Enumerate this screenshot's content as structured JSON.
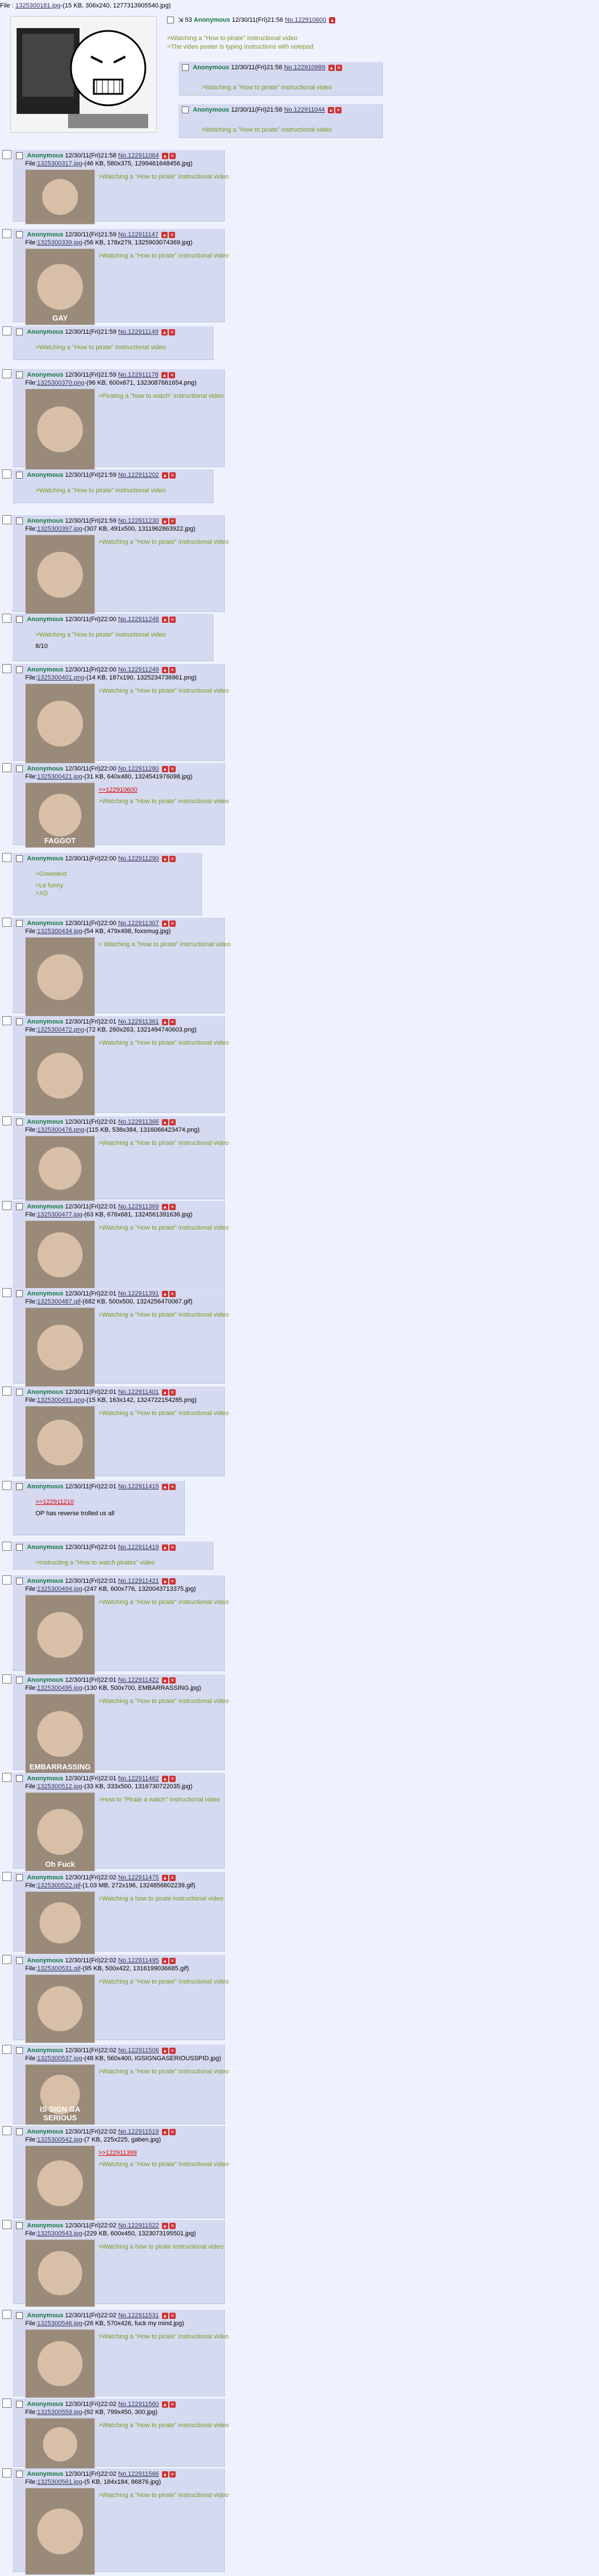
{
  "op": {
    "file_prefix": "File : ",
    "file_name": "1325300181.jpg",
    "file_info": "-(15 KB, 306x240, 1277313905540.jpg)",
    "reply_count": "53",
    "name": "Anonymous",
    "datetime": "12/30/11(Fri)21:56",
    "post_no": "No.122910600",
    "message": [
      ">Watching a \"How to pirate\" instructional video",
      ">The video poster is typing instructions with notepad"
    ],
    "nested_replies": [
      {
        "name": "Anonymous",
        "datetime": "12/30/11(Fri)21:58",
        "post_no": "No.122910999",
        "message": ">Watching a \"How to pirate\" instructional video"
      },
      {
        "name": "Anonymous",
        "datetime": "12/30/11(Fri)21:58",
        "post_no": "No.122911044",
        "message": ">Watching a \"How to pirate\" instructional video"
      }
    ]
  },
  "replies": [
    {
      "name": "Anonymous",
      "datetime": "12/30/11(Fri)21:58",
      "post_no": "No.122911064",
      "file_prefix": "File:",
      "file_name": "1325300317.jpg",
      "file_info": "-(46 KB, 580x375, 1299461648456.jpg)",
      "message": ">Watching a \"How to pirate\" instructional video"
    },
    {
      "name": "Anonymous",
      "datetime": "12/30/11(Fri)21:59",
      "post_no": "No.122911147",
      "file_prefix": "File:",
      "file_name": "1325300339.jpg",
      "file_info": "-(56 KB, 178x279, 1325903074369.jpg)",
      "message": ">Watching a \"How to pirate\" instructional video",
      "thumb_text": "GAY"
    },
    {
      "name": "Anonymous",
      "datetime": "12/30/11(Fri)21:59",
      "post_no": "No.122911149",
      "message": ">Watching a \"How to pirate\" instructional video"
    },
    {
      "name": "Anonymous",
      "datetime": "12/30/11(Fri)21:59",
      "post_no": "No.122911178",
      "file_prefix": "File:",
      "file_name": "1325300370.png",
      "file_info": "-(96 KB, 600x671, 1323087661654.png)",
      "message": ">Pirating a \"how to watch\" instructional video"
    },
    {
      "name": "Anonymous",
      "datetime": "12/30/11(Fri)21:59",
      "post_no": "No.122911202",
      "message": ">Watching a \"How to pirate\" instructional video"
    },
    {
      "name": "Anonymous",
      "datetime": "12/30/11(Fri)21:59",
      "post_no": "No.122911230",
      "file_prefix": "File:",
      "file_name": "1325300397.jpg",
      "file_info": "-(307 KB, 491x500, 1311962863922.jpg)",
      "message": ">Watching a \"How to pirate\" instructional video"
    },
    {
      "name": "Anonymous",
      "datetime": "12/30/11(Fri)22:00",
      "post_no": "No.122911248",
      "message": ">Watching a \"How to pirate\" instructional video",
      "message2": "8/10"
    },
    {
      "name": "Anonymous",
      "datetime": "12/30/11(Fri)22:00",
      "post_no": "No.122911249",
      "file_prefix": "File:",
      "file_name": "1325300401.png",
      "file_info": "-(14 KB, 187x190, 1325234736961.png)",
      "message": ">Watching a \"How to pirate\" instructional video"
    },
    {
      "name": "Anonymous",
      "datetime": "12/30/11(Fri)22:00",
      "post_no": "No.122911280",
      "file_prefix": "File:",
      "file_name": "1325300421.jpg",
      "file_info": "-(31 KB, 640x480, 1324541976098.jpg)",
      "message": ">>122910600",
      "message2": ">Watching a \"How to pirate\" instructional video",
      "thumb_text": "FAGGOT"
    },
    {
      "name": "Anonymous",
      "datetime": "12/30/11(Fri)22:00",
      "post_no": "No.122911290",
      "message": ">Greentext",
      "message2": ">Le funny",
      "message3": ">XD"
    },
    {
      "name": "Anonymous",
      "datetime": "12/30/11(Fri)22:00",
      "post_no": "No.122911307",
      "file_prefix": "File:",
      "file_name": "1325300434.jpg",
      "file_info": "-(54 KB, 479x498, foxsmug.jpg)",
      "message": "> Watching a \"How to pirate\" instructional video"
    },
    {
      "name": "Anonymous",
      "datetime": "12/30/11(Fri)22:01",
      "post_no": "No.122911361",
      "file_prefix": "File:",
      "file_name": "1325300472.png",
      "file_info": "-(72 KB, 260x263, 1321494740603.png)",
      "message": ">Watching a \"How to pirate\" instructional video"
    },
    {
      "name": "Anonymous",
      "datetime": "12/30/11(Fri)22:01",
      "post_no": "No.122911366",
      "file_prefix": "File:",
      "file_name": "1325300476.png",
      "file_info": "-(115 KB, 538x384, 1316066423474.png)",
      "message": ">Watching a \"How to pirate\" instructional video"
    },
    {
      "name": "Anonymous",
      "datetime": "12/30/11(Fri)22:01",
      "post_no": "No.122911369",
      "file_prefix": "File:",
      "file_name": "1325300477.jpg",
      "file_info": "-(63 KB, 676x681, 1324561391636.jpg)",
      "message": ">Watching a \"How to pirate\" instructional video"
    },
    {
      "name": "Anonymous",
      "datetime": "12/30/11(Fri)22:01",
      "post_no": "No.122911391",
      "file_prefix": "File:",
      "file_name": "1325300487.gif",
      "file_info": "-(682 KB, 500x500, 1324256470067.gif)",
      "message": ">Watching a \"How to pirate\" instructional video"
    },
    {
      "name": "Anonymous",
      "datetime": "12/30/11(Fri)22:01",
      "post_no": "No.122911401",
      "file_prefix": "File:",
      "file_name": "1325300491.png",
      "file_info": "-(15 KB, 163x142, 1324722154285.png)",
      "message": ">Watching a \"How to pirate\" instructional video"
    },
    {
      "name": "Anonymous",
      "datetime": "12/30/11(Fri)22:01",
      "post_no": "No.122911415",
      "message": ">>122911210",
      "message2": "OP has reverse trolled us all"
    },
    {
      "name": "Anonymous",
      "datetime": "12/30/11(Fri)22:01",
      "post_no": "No.122911419",
      "message": ">Instructing a \"How to watch pirates\" video"
    },
    {
      "name": "Anonymous",
      "datetime": "12/30/11(Fri)22:01",
      "post_no": "No.122911421",
      "file_prefix": "File:",
      "file_name": "1325300494.jpg",
      "file_info": "-(247 KB, 600x776, 1320043713375.jpg)",
      "message": ">Watching a \"How to pirate\" instructional video"
    },
    {
      "name": "Anonymous",
      "datetime": "12/30/11(Fri)22:01",
      "post_no": "No.122911422",
      "file_prefix": "File:",
      "file_name": "1325300495.jpg",
      "file_info": "-(130 KB, 500x700, EMBARRASSING.jpg)",
      "message": ">Watching a \"How to pirate\" instructional video",
      "thumb_text": "EMBARRASSING"
    },
    {
      "name": "Anonymous",
      "datetime": "12/30/11(Fri)22:01",
      "post_no": "No.122911462",
      "file_prefix": "File:",
      "file_name": "1325300512.jpg",
      "file_info": "-(33 KB, 333x500, 1316730722035.jpg)",
      "message": ">How to \"Pirate a watch\" instructional video",
      "thumb_text": "Oh Fuck"
    },
    {
      "name": "Anonymous",
      "datetime": "12/30/11(Fri)22:02",
      "post_no": "No.122911475",
      "file_prefix": "File:",
      "file_name": "1325300522.gif",
      "file_info": "-(1.03 MB, 272x196, 1324856802239.gif)",
      "message": ">Watching a how to pirate instructional video"
    },
    {
      "name": "Anonymous",
      "datetime": "12/30/11(Fri)22:02",
      "post_no": "No.122911495",
      "file_prefix": "File:",
      "file_name": "1325300531.gif",
      "file_info": "-(95 KB, 500x422, 1316199036685.gif)",
      "message": ">Watching a \"How to pirate\" instructional video"
    },
    {
      "name": "Anonymous",
      "datetime": "12/30/11(Fri)22:02",
      "post_no": "No.122911506",
      "file_prefix": "File:",
      "file_name": "1325300537.jpg",
      "file_info": "-(48 KB, 560x400, IGSIGNGASERIOUSSPID.jpg)",
      "message": ">Watching a \"How to pirate\" instructional video",
      "thumb_text": "IS SIGN GA SERIOUS"
    },
    {
      "name": "Anonymous",
      "datetime": "12/30/11(Fri)22:02",
      "post_no": "No.122911519",
      "file_prefix": "File:",
      "file_name": "1325300542.jpg",
      "file_info": "-(7 KB, 225x225, gaben.jpg)",
      "message": ">>122911399",
      "message2": ">Watching a \"How to pirate\" instructional video"
    },
    {
      "name": "Anonymous",
      "datetime": "12/30/11(Fri)22:02",
      "post_no": "No.122911522",
      "file_prefix": "File:",
      "file_name": "1325300543.jpg",
      "file_info": "-(229 KB, 600x450, 1323073195501.jpg)",
      "message": ">Watching a how to pirate instructional video"
    },
    {
      "name": "Anonymous",
      "datetime": "12/30/11(Fri)22:02",
      "post_no": "No.122911531",
      "file_prefix": "File:",
      "file_name": "1325300546.jpg",
      "file_info": "-(26 KB, 570x426, fuck my mind.jpg)",
      "message": ">Watching a \"How to pirate\" instructional video"
    },
    {
      "name": "Anonymous",
      "datetime": "12/30/11(Fri)22:02",
      "post_no": "No.122911560",
      "file_prefix": "File:",
      "file_name": "1325300559.jpg",
      "file_info": "-(92 KB, 799x450, 300.jpg)",
      "message": ">Watching a \"How to pirate\" instructional video"
    },
    {
      "name": "Anonymous",
      "datetime": "12/30/11(Fri)22:02",
      "post_no": "No.122911566",
      "file_prefix": "File:",
      "file_name": "1325300561.jpg",
      "file_info": "-(5 KB, 184x184, 86876.jpg)",
      "message": ">Watching a \"How to pirate\" instructional video"
    }
  ],
  "colors": {
    "reply_bg": "#d6daf0",
    "page_bg": "#eef2ff",
    "name": "#117743",
    "quote": "#789922",
    "link": "#dd0000"
  }
}
